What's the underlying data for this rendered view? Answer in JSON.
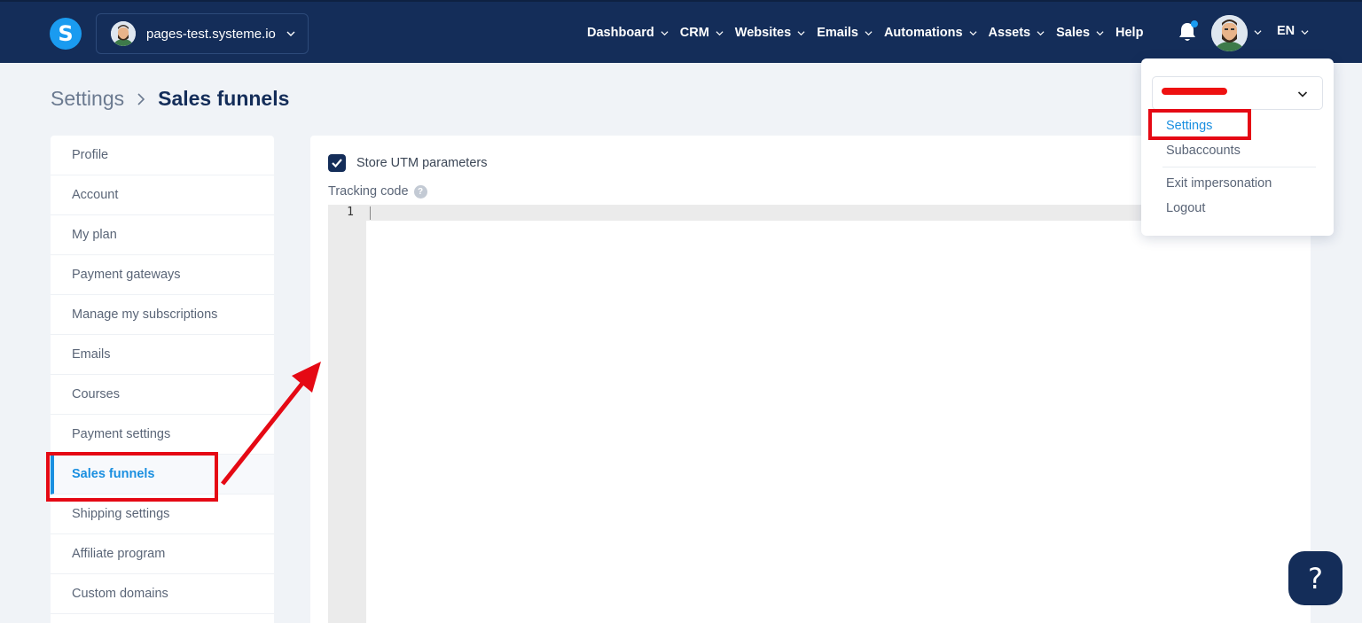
{
  "topbar": {
    "logo_letter": "S",
    "workspace_name": "pages-test.systeme.io",
    "nav": [
      {
        "label": "Dashboard",
        "dropdown": true
      },
      {
        "label": "CRM",
        "dropdown": true
      },
      {
        "label": "Websites",
        "dropdown": true
      },
      {
        "label": "Emails",
        "dropdown": true
      },
      {
        "label": "Automations",
        "dropdown": true
      },
      {
        "label": "Assets",
        "dropdown": true
      },
      {
        "label": "Sales",
        "dropdown": true
      },
      {
        "label": "Help",
        "dropdown": false
      }
    ],
    "language": "EN",
    "colors": {
      "bar": "#142d59",
      "accent": "#1a9bf0"
    }
  },
  "breadcrumb": {
    "root": "Settings",
    "current": "Sales funnels"
  },
  "sidebar": {
    "items": [
      {
        "label": "Profile"
      },
      {
        "label": "Account"
      },
      {
        "label": "My plan"
      },
      {
        "label": "Payment gateways"
      },
      {
        "label": "Manage my subscriptions"
      },
      {
        "label": "Emails"
      },
      {
        "label": "Courses"
      },
      {
        "label": "Payment settings"
      },
      {
        "label": "Sales funnels",
        "active": true
      },
      {
        "label": "Shipping settings"
      },
      {
        "label": "Affiliate program"
      },
      {
        "label": "Custom domains"
      }
    ]
  },
  "main": {
    "store_utm": {
      "label": "Store UTM parameters",
      "checked": true
    },
    "tracking_code_label": "Tracking code",
    "help_glyph": "?",
    "editor": {
      "line_number": "1",
      "content": ""
    }
  },
  "dropdown": {
    "items": [
      {
        "label": "Settings",
        "active": true
      },
      {
        "label": "Subaccounts"
      },
      {
        "label": "Exit impersonation"
      },
      {
        "label": "Logout"
      }
    ]
  },
  "help_button": {
    "glyph": "?"
  },
  "annotation_color": "#e50914"
}
